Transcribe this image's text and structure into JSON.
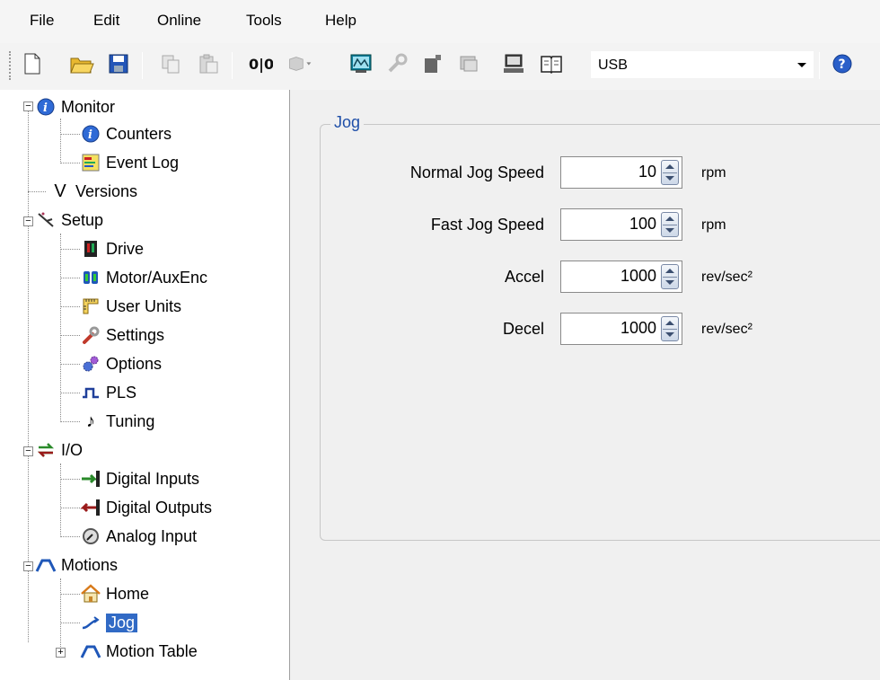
{
  "menu": [
    "File",
    "Edit",
    "Online",
    "Tools",
    "Help"
  ],
  "toolbar": {
    "connection_value": "USB",
    "icons": [
      "new-file-icon",
      "open-folder-icon",
      "save-icon",
      "copy-icon",
      "paste-icon",
      "scope-icon",
      "drive-icon",
      "monitor-icon",
      "wrench-icon",
      "configure-icon",
      "window-icon",
      "computer-icon",
      "book-icon",
      "help-icon"
    ]
  },
  "tree": {
    "monitor": "Monitor",
    "counters": "Counters",
    "event_log": "Event Log",
    "versions": "Versions",
    "versions_glyph": "V",
    "setup": "Setup",
    "drive": "Drive",
    "motor": "Motor/AuxEnc",
    "user_units": "User Units",
    "settings": "Settings",
    "options": "Options",
    "pls": "PLS",
    "tuning": "Tuning",
    "io": "I/O",
    "digital_inputs": "Digital Inputs",
    "digital_outputs": "Digital Outputs",
    "analog_input": "Analog Input",
    "motions": "Motions",
    "home": "Home",
    "jog": "Jog",
    "motion_table": "Motion Table"
  },
  "jog": {
    "title": "Jog",
    "fields": [
      {
        "label": "Normal Jog Speed",
        "value": "10",
        "unit": "rpm"
      },
      {
        "label": "Fast Jog Speed",
        "value": "100",
        "unit": "rpm"
      },
      {
        "label": "Accel",
        "value": "1000",
        "unit": "rev/sec²"
      },
      {
        "label": "Decel",
        "value": "1000",
        "unit": "rev/sec²"
      }
    ]
  },
  "colors": {
    "selection": "#316ac5",
    "group_title": "#1f4fa8"
  }
}
